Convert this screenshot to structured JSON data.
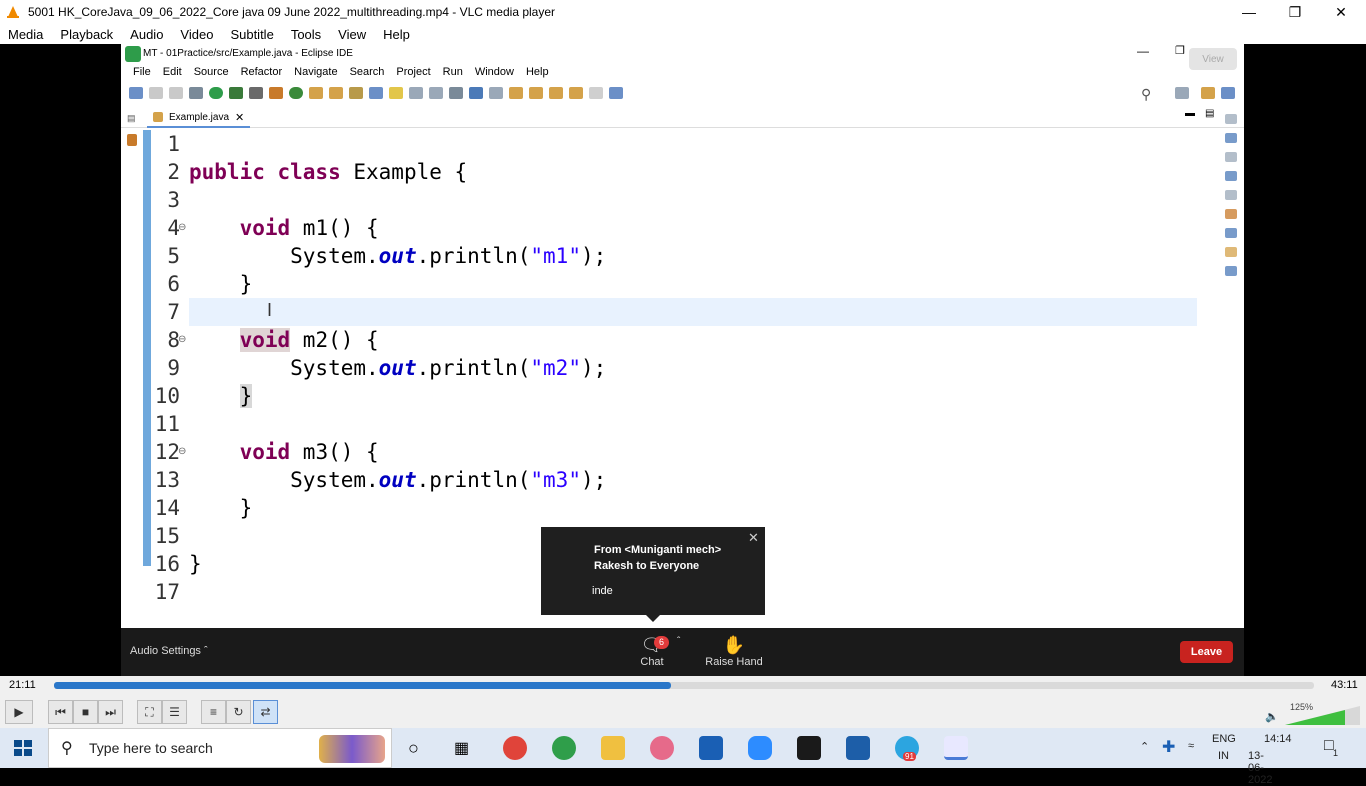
{
  "vlc": {
    "title": "5001 HK_CoreJava_09_06_2022_Core java 09 June 2022_multithreading.mp4 - VLC media player",
    "menu": [
      "Media",
      "Playback",
      "Audio",
      "Video",
      "Subtitle",
      "Tools",
      "View",
      "Help"
    ],
    "time_elapsed": "21:11",
    "time_total": "43:11",
    "progress": 0.49,
    "volume_label": "125%",
    "volume_level": 1.25
  },
  "eclipse": {
    "title": "MT - 01Practice/src/Example.java - Eclipse IDE",
    "menu": [
      "File",
      "Edit",
      "Source",
      "Refactor",
      "Navigate",
      "Search",
      "Project",
      "Run",
      "Window",
      "Help"
    ],
    "view_button": "View",
    "tab": "Example.java"
  },
  "code_lines": [
    {
      "n": "1",
      "parts": []
    },
    {
      "n": "2",
      "parts": [
        {
          "t": "public class ",
          "c": "kw"
        },
        {
          "t": "Example {",
          "c": ""
        }
      ]
    },
    {
      "n": "3",
      "parts": []
    },
    {
      "n": "4",
      "fold": true,
      "parts": [
        {
          "t": "    ",
          "c": ""
        },
        {
          "t": "void",
          "c": "kw"
        },
        {
          "t": " m1() {",
          "c": ""
        }
      ]
    },
    {
      "n": "5",
      "parts": [
        {
          "t": "        System.",
          "c": ""
        },
        {
          "t": "out",
          "c": "it"
        },
        {
          "t": ".println(",
          "c": ""
        },
        {
          "t": "\"m1\"",
          "c": "str"
        },
        {
          "t": ");",
          "c": ""
        }
      ]
    },
    {
      "n": "6",
      "parts": [
        {
          "t": "    }",
          "c": ""
        }
      ]
    },
    {
      "n": "7",
      "parts": []
    },
    {
      "n": "8",
      "fold": true,
      "parts": [
        {
          "t": "    ",
          "c": ""
        },
        {
          "t": "void",
          "c": "kw hl"
        },
        {
          "t": " m2() {",
          "c": ""
        }
      ]
    },
    {
      "n": "9",
      "parts": [
        {
          "t": "        System.",
          "c": ""
        },
        {
          "t": "out",
          "c": "it"
        },
        {
          "t": ".println(",
          "c": ""
        },
        {
          "t": "\"m2\"",
          "c": "str"
        },
        {
          "t": ");",
          "c": ""
        }
      ]
    },
    {
      "n": "10",
      "parts": [
        {
          "t": "    ",
          "c": ""
        },
        {
          "t": "}",
          "c": "hl2"
        }
      ]
    },
    {
      "n": "11",
      "parts": []
    },
    {
      "n": "12",
      "fold": true,
      "parts": [
        {
          "t": "    ",
          "c": ""
        },
        {
          "t": "void",
          "c": "kw"
        },
        {
          "t": " m3() {",
          "c": ""
        }
      ]
    },
    {
      "n": "13",
      "parts": [
        {
          "t": "        System.",
          "c": ""
        },
        {
          "t": "out",
          "c": "it"
        },
        {
          "t": ".println(",
          "c": ""
        },
        {
          "t": "\"m3\"",
          "c": "str"
        },
        {
          "t": ");",
          "c": ""
        }
      ]
    },
    {
      "n": "14",
      "parts": [
        {
          "t": "    }",
          "c": ""
        }
      ]
    },
    {
      "n": "15",
      "parts": []
    },
    {
      "n": "16",
      "parts": [
        {
          "t": "}",
          "c": ""
        }
      ]
    },
    {
      "n": "17",
      "parts": []
    }
  ],
  "chat_popup": {
    "from_line1": "From <Muniganti mech>",
    "from_line2": "Rakesh to Everyone",
    "message": "inde"
  },
  "zoom": {
    "audio_settings": "Audio Settings",
    "chat_label": "Chat",
    "chat_badge": "6",
    "raise_hand": "Raise Hand",
    "leave": "Leave"
  },
  "taskbar": {
    "search_placeholder": "Type here to search",
    "lang_top": "ENG",
    "lang_bottom": "IN",
    "time": "14:14",
    "date": "13-06-2022",
    "notif_count": "1",
    "telegram_badge": "91"
  }
}
